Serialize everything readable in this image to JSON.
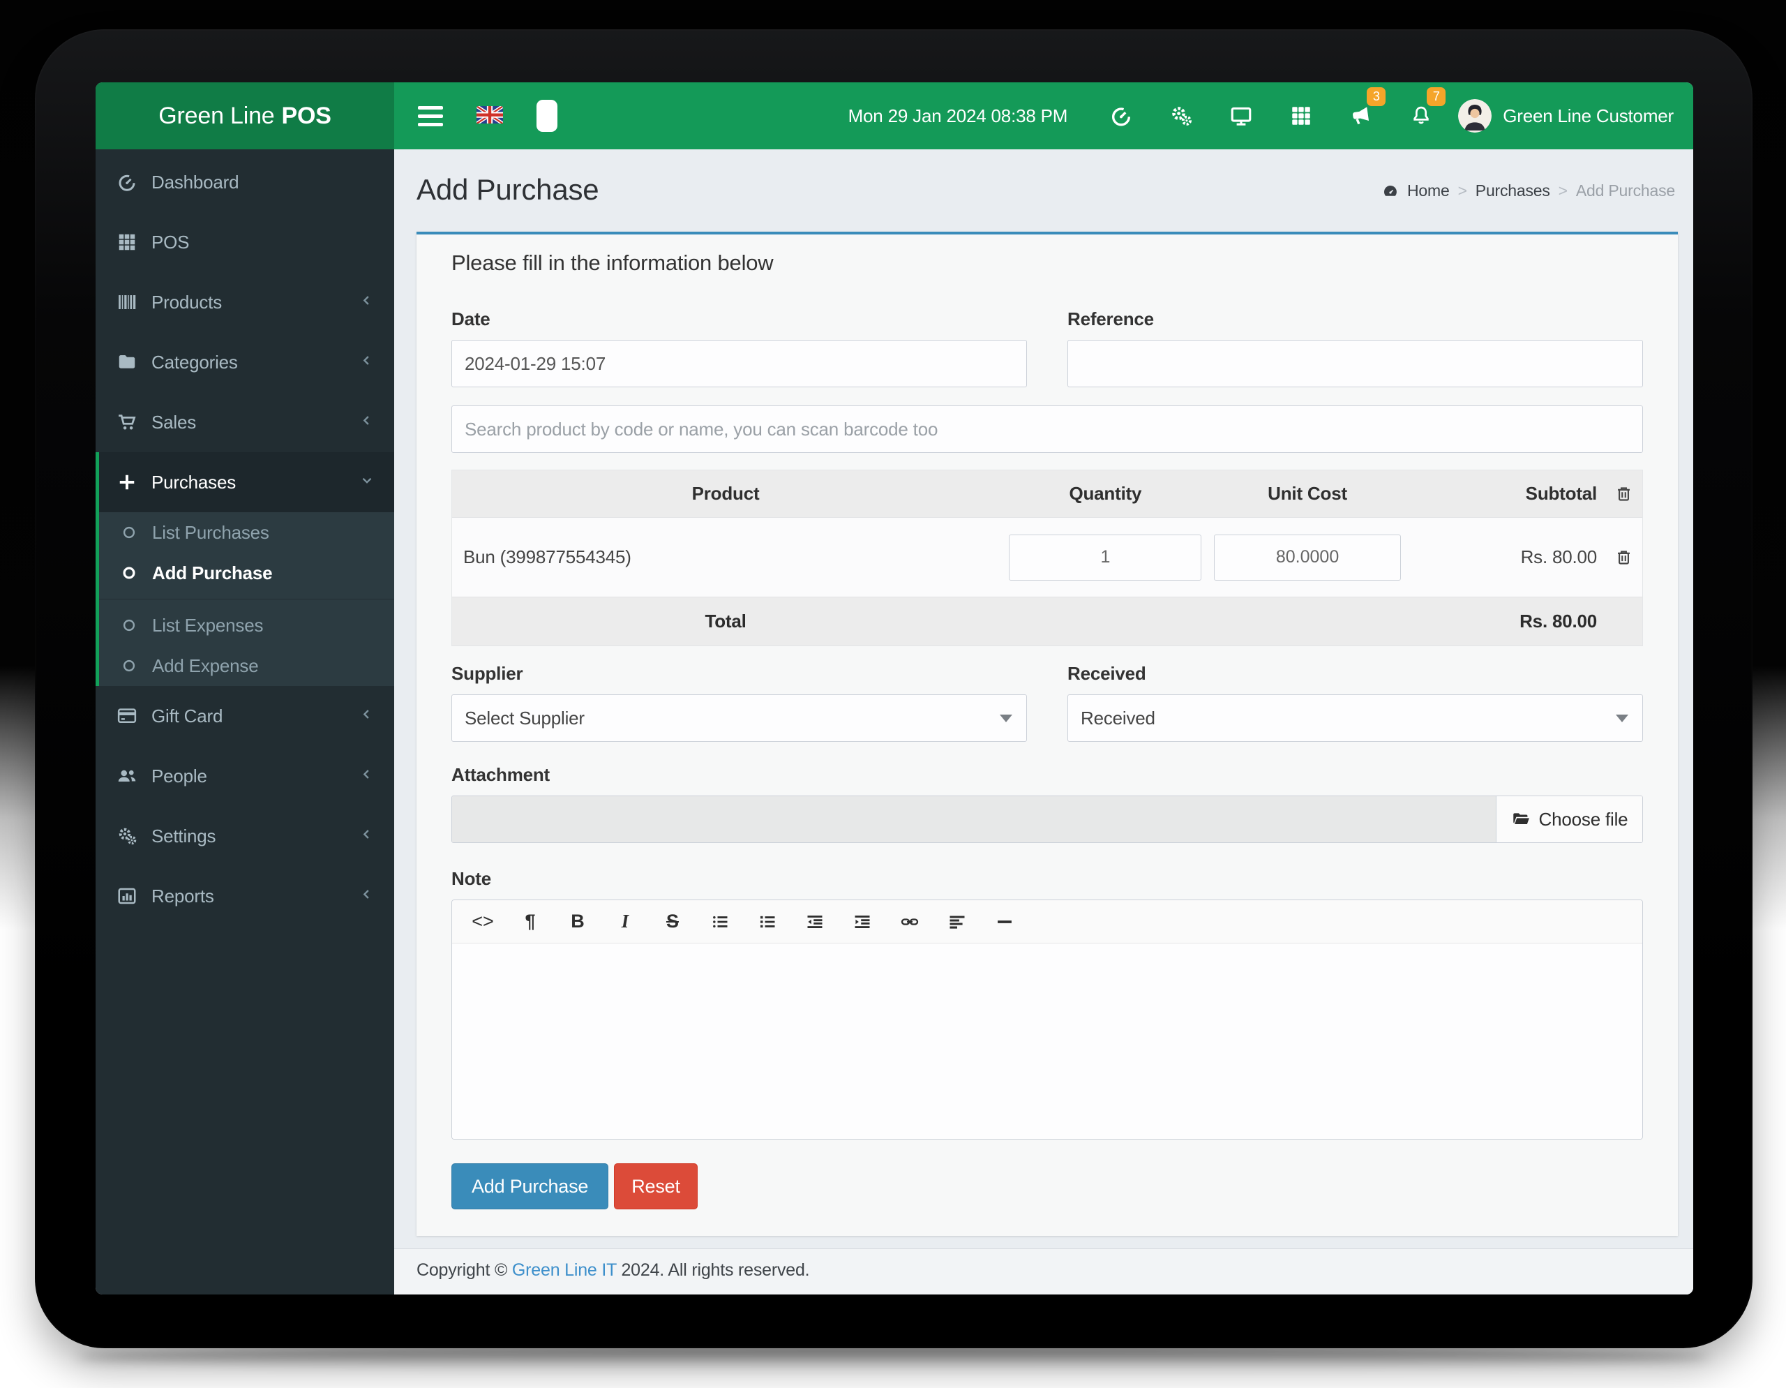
{
  "brand": {
    "name": "Green Line",
    "suffix": "POS"
  },
  "navbar": {
    "datetime": "Mon 29 Jan 2024 08:38 PM",
    "user_name": "Green Line Customer",
    "announcement_badge": "3",
    "notification_badge": "7"
  },
  "sidebar": {
    "items": [
      {
        "label": "Dashboard",
        "icon": "gauge-icon"
      },
      {
        "label": "POS",
        "icon": "grid-icon"
      },
      {
        "label": "Products",
        "icon": "barcode-icon"
      },
      {
        "label": "Categories",
        "icon": "folder-icon"
      },
      {
        "label": "Sales",
        "icon": "cart-icon"
      },
      {
        "label": "Purchases",
        "icon": "plus-icon",
        "children": [
          {
            "label": "List Purchases"
          },
          {
            "label": "Add Purchase",
            "active": true
          },
          {
            "label": "List Expenses"
          },
          {
            "label": "Add Expense"
          }
        ]
      },
      {
        "label": "Gift Card",
        "icon": "credit-card-icon"
      },
      {
        "label": "People",
        "icon": "users-icon"
      },
      {
        "label": "Settings",
        "icon": "cogs-icon"
      },
      {
        "label": "Reports",
        "icon": "bar-chart-icon"
      }
    ]
  },
  "page": {
    "title": "Add Purchase",
    "breadcrumb": [
      {
        "label": "Home"
      },
      {
        "label": "Purchases"
      },
      {
        "label": "Add Purchase"
      }
    ],
    "breadcrumb_separator": ">"
  },
  "form": {
    "heading": "Please fill in the information below",
    "date": {
      "label": "Date",
      "value": "2024-01-29 15:07"
    },
    "reference": {
      "label": "Reference",
      "value": ""
    },
    "search": {
      "placeholder": "Search product by code or name, you can scan barcode too"
    },
    "supplier": {
      "label": "Supplier",
      "value": "Select Supplier"
    },
    "received": {
      "label": "Received",
      "value": "Received"
    },
    "attachment": {
      "label": "Attachment",
      "button": "Choose file"
    },
    "note": {
      "label": "Note",
      "toolbar_glyphs": {
        "code": "<>",
        "paragraph": "¶",
        "bold": "B",
        "italic": "I",
        "strike": "S"
      }
    },
    "buttons": {
      "submit": "Add Purchase",
      "reset": "Reset"
    }
  },
  "table": {
    "headers": [
      "Product",
      "Quantity",
      "Unit Cost",
      "Subtotal"
    ],
    "rows": [
      {
        "product": "Bun (399877554345)",
        "quantity": "1",
        "unit_cost": "80.0000",
        "subtotal": "Rs. 80.00"
      }
    ],
    "total_label": "Total",
    "total_value": "Rs. 80.00"
  },
  "footer": {
    "prefix": "Copyright © ",
    "company": "Green Line IT",
    "suffix": " 2024. All rights reserved."
  },
  "colors": {
    "navbar_green": "#149a58",
    "logo_green": "#107c46",
    "sidebar_dark": "#222d32",
    "submenu_dark": "#2c3b41",
    "active_border_green": "#12a15a",
    "accent_blue": "#3a8cba",
    "danger_red": "#dc4b39",
    "badge_orange": "#f5a52a",
    "link_blue": "#3d8fcb"
  }
}
